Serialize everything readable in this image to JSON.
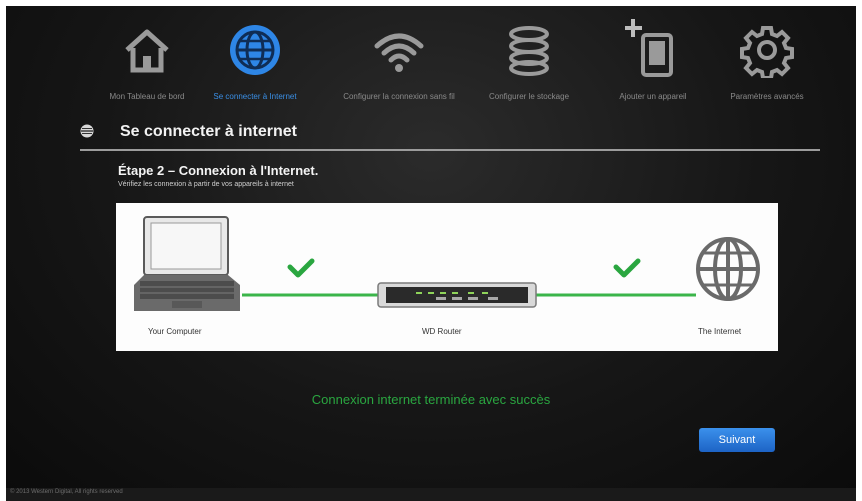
{
  "nav": {
    "items": [
      {
        "label": "Mon Tableau de bord",
        "icon": "home-icon",
        "active": false
      },
      {
        "label": "Se connecter à Internet",
        "icon": "globe-icon",
        "active": true
      },
      {
        "label": "Configurer la connexion sans fil",
        "icon": "wifi-icon",
        "active": false
      },
      {
        "label": "Configurer le stockage",
        "icon": "storage-icon",
        "active": false
      },
      {
        "label": "Ajouter un appareil",
        "icon": "add-device-icon",
        "active": false
      },
      {
        "label": "Paramètres avancés",
        "icon": "gear-icon",
        "active": false
      }
    ]
  },
  "section": {
    "title": "Se connecter à internet"
  },
  "step": {
    "title": "Étape 2 – Connexion à l'Internet.",
    "subtitle": "Vérifiez les connexion à partir de vos appareils à internet"
  },
  "diagram": {
    "computer_label": "Your Computer",
    "router_label": "WD Router",
    "internet_label": "The Internet"
  },
  "status": {
    "message": "Connexion internet terminée avec succès"
  },
  "actions": {
    "next_label": "Suivant"
  },
  "footer": {
    "text": "© 2013 Western Digital, All rights reserved"
  },
  "colors": {
    "accent": "#3a8fe6",
    "success": "#2aa640",
    "line": "#3bb54a"
  }
}
